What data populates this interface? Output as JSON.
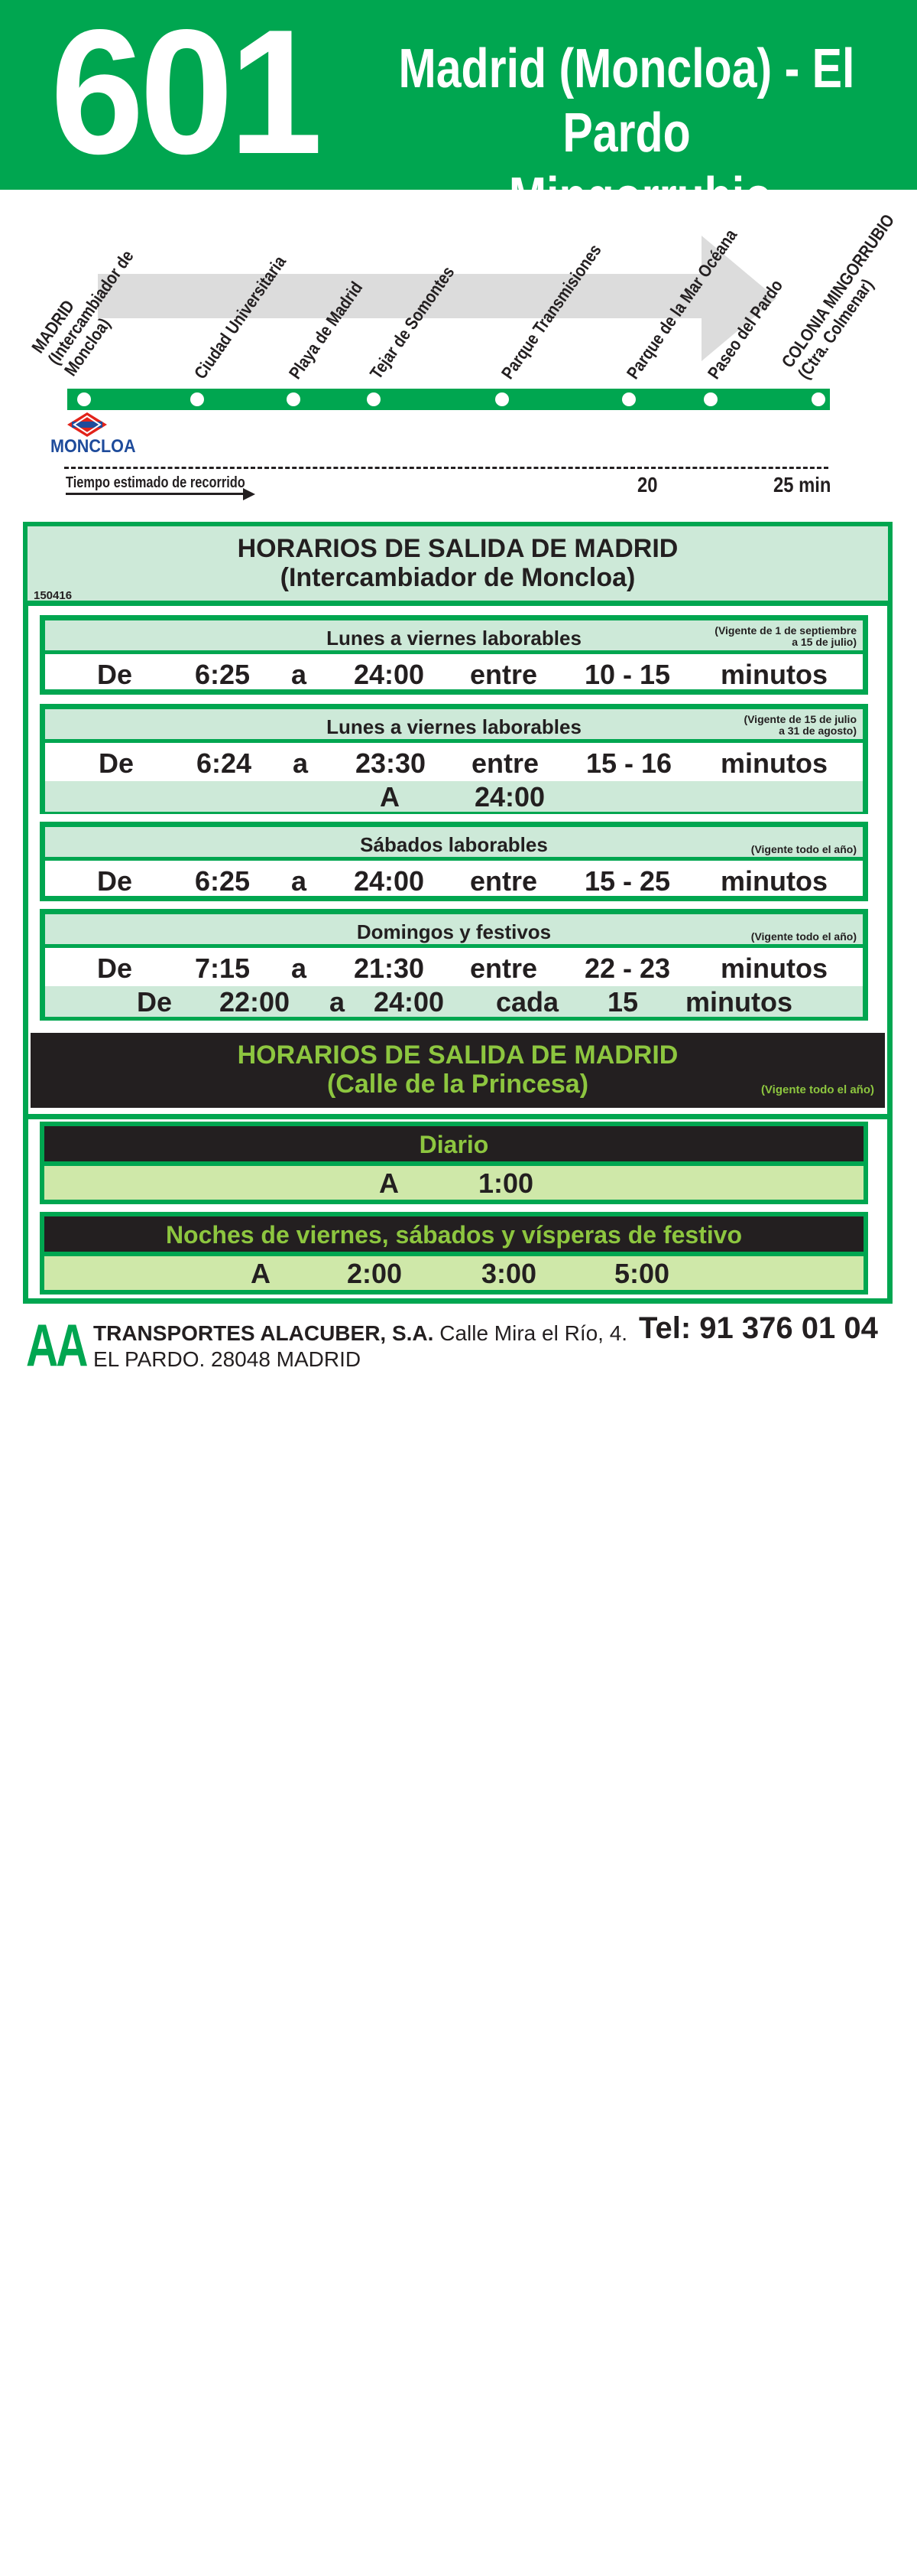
{
  "header": {
    "route_number": "601",
    "title_line1": "Madrid (Moncloa) - El Pardo",
    "title_line2": "- Mingorrubio"
  },
  "diagram": {
    "stops": [
      "MADRID\n(Intercambiador de\nMoncloa)",
      "Ciudad Universitaria",
      "Playa de Madrid",
      "Tejar de Somontes",
      "Parque Transmisiones",
      "Parque de la Mar Océana",
      "Paseo del Pardo",
      "COLONIA MINGORRUBIO\n(Ctra. Colmenar)"
    ],
    "metro_name": "MONCLOA",
    "travel_time_label": "Tiempo estimado de recorrido",
    "time_marks": [
      "20",
      "25 min"
    ]
  },
  "section1": {
    "title_line1": "HORARIOS DE SALIDA DE MADRID",
    "title_line2": "(Intercambiador de Moncloa)",
    "code": "150416",
    "schedules": [
      {
        "title": "Lunes a viernes laborables",
        "note_line1": "(Vigente de 1 de septiembre",
        "note_line2": "a 15 de julio)",
        "row": [
          "De",
          "6:25",
          "a",
          "24:00",
          "entre",
          "10 - 15",
          "minutos"
        ]
      },
      {
        "title": "Lunes a viernes laborables",
        "note_line1": "(Vigente de 15 de julio",
        "note_line2": "a 31 de agosto)",
        "row": [
          "De",
          "6:24",
          "a",
          "23:30",
          "entre",
          "15 - 16",
          "minutos"
        ],
        "row2": [
          "A",
          "24:00"
        ]
      },
      {
        "title": "Sábados laborables",
        "note": "(Vigente todo el año)",
        "row": [
          "De",
          "6:25",
          "a",
          "24:00",
          "entre",
          "15 - 25",
          "minutos"
        ]
      },
      {
        "title": "Domingos y festivos",
        "note": "(Vigente todo el año)",
        "row": [
          "De",
          "7:15",
          "a",
          "21:30",
          "entre",
          "22 - 23",
          "minutos"
        ],
        "row2": [
          "De",
          "22:00",
          "a",
          "24:00",
          "cada",
          "15",
          "minutos"
        ]
      }
    ]
  },
  "section2": {
    "title_line1": "HORARIOS DE SALIDA DE MADRID",
    "title_line2": "(Calle de la Princesa)",
    "note": "(Vigente todo el año)",
    "daily_label": "Diario",
    "daily_row": [
      "A",
      "1:00"
    ],
    "nights_label": "Noches de viernes, sábados y vísperas de festivo",
    "nights_row": [
      "A",
      "2:00",
      "3:00",
      "5:00"
    ]
  },
  "footer": {
    "logo": "AA",
    "company_name": "TRANSPORTES ALACUBER, S.A.",
    "address1": " Calle Mira el Río, 4.",
    "address2": "EL PARDO. 28048 MADRID",
    "phone": "Tel: 91 376 01 04"
  },
  "colors": {
    "green": "#00a650",
    "light_green": "#cde9d8",
    "lime": "#8dc63f",
    "dark": "#231f20",
    "metro_blue": "#1e4b9b",
    "metro_red": "#e2231a"
  }
}
